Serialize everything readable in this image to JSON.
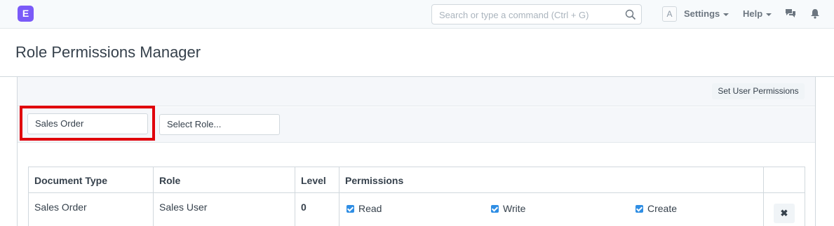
{
  "navbar": {
    "logo_letter": "E",
    "search_placeholder": "Search or type a command (Ctrl + G)",
    "avatar_letter": "A",
    "settings_label": "Settings",
    "help_label": "Help"
  },
  "page": {
    "title": "Role Permissions Manager"
  },
  "toolbar": {
    "set_user_permissions_label": "Set User Permissions"
  },
  "filters": {
    "document_type_value": "Sales Order",
    "role_placeholder": "Select Role..."
  },
  "table": {
    "headers": [
      "Document Type",
      "Role",
      "Level",
      "Permissions",
      ""
    ],
    "rows": [
      {
        "document_type": "Sales Order",
        "role": "Sales User",
        "level": "0",
        "permissions": [
          {
            "label": "Read",
            "checked": true
          },
          {
            "label": "Write",
            "checked": true
          },
          {
            "label": "Create",
            "checked": true
          }
        ],
        "delete_icon": "✖"
      }
    ]
  },
  "colors": {
    "brand": "#7a5af8",
    "checkbox": "#2f8ee4",
    "highlight": "#e0000b"
  }
}
